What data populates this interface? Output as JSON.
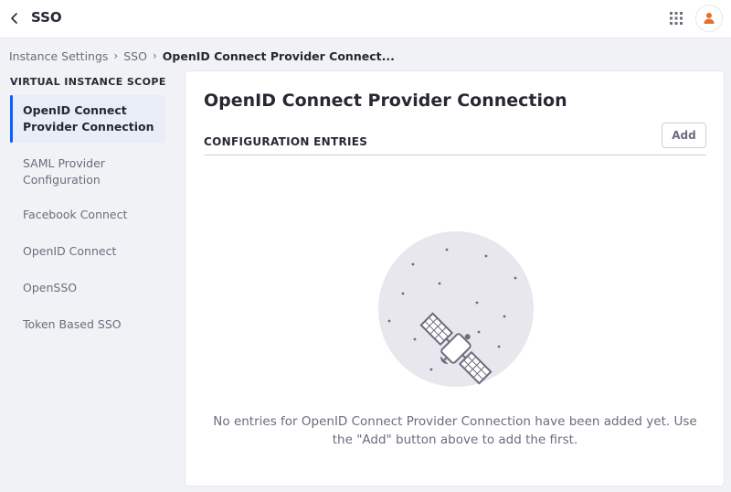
{
  "header": {
    "title": "SSO",
    "back_icon": "chevron-left-icon",
    "apps_icon": "grid-icon",
    "avatar_icon": "user-icon",
    "avatar_color": "#e5702b"
  },
  "breadcrumb": {
    "items": [
      "Instance Settings",
      "SSO"
    ],
    "current": "OpenID Connect Provider Connect..."
  },
  "sidebar": {
    "scope_label": "VIRTUAL INSTANCE SCOPE",
    "items": [
      {
        "label": "OpenID Connect Provider Connection",
        "active": true
      },
      {
        "label": "SAML Provider Configuration",
        "active": false
      },
      {
        "label": "Facebook Connect",
        "active": false
      },
      {
        "label": "OpenID Connect",
        "active": false
      },
      {
        "label": "OpenSSO",
        "active": false
      },
      {
        "label": "Token Based SSO",
        "active": false
      }
    ]
  },
  "main": {
    "title": "OpenID Connect Provider Connection",
    "section_title": "CONFIGURATION ENTRIES",
    "add_label": "Add",
    "empty_icon": "satellite-icon",
    "empty_message": "No entries for OpenID Connect Provider Connection have been added yet. Use the \"Add\" button above to add the first."
  },
  "colors": {
    "accent": "#0b5fff",
    "active_bg": "#e8edf8",
    "illustration_bg": "#e7e7ed"
  }
}
